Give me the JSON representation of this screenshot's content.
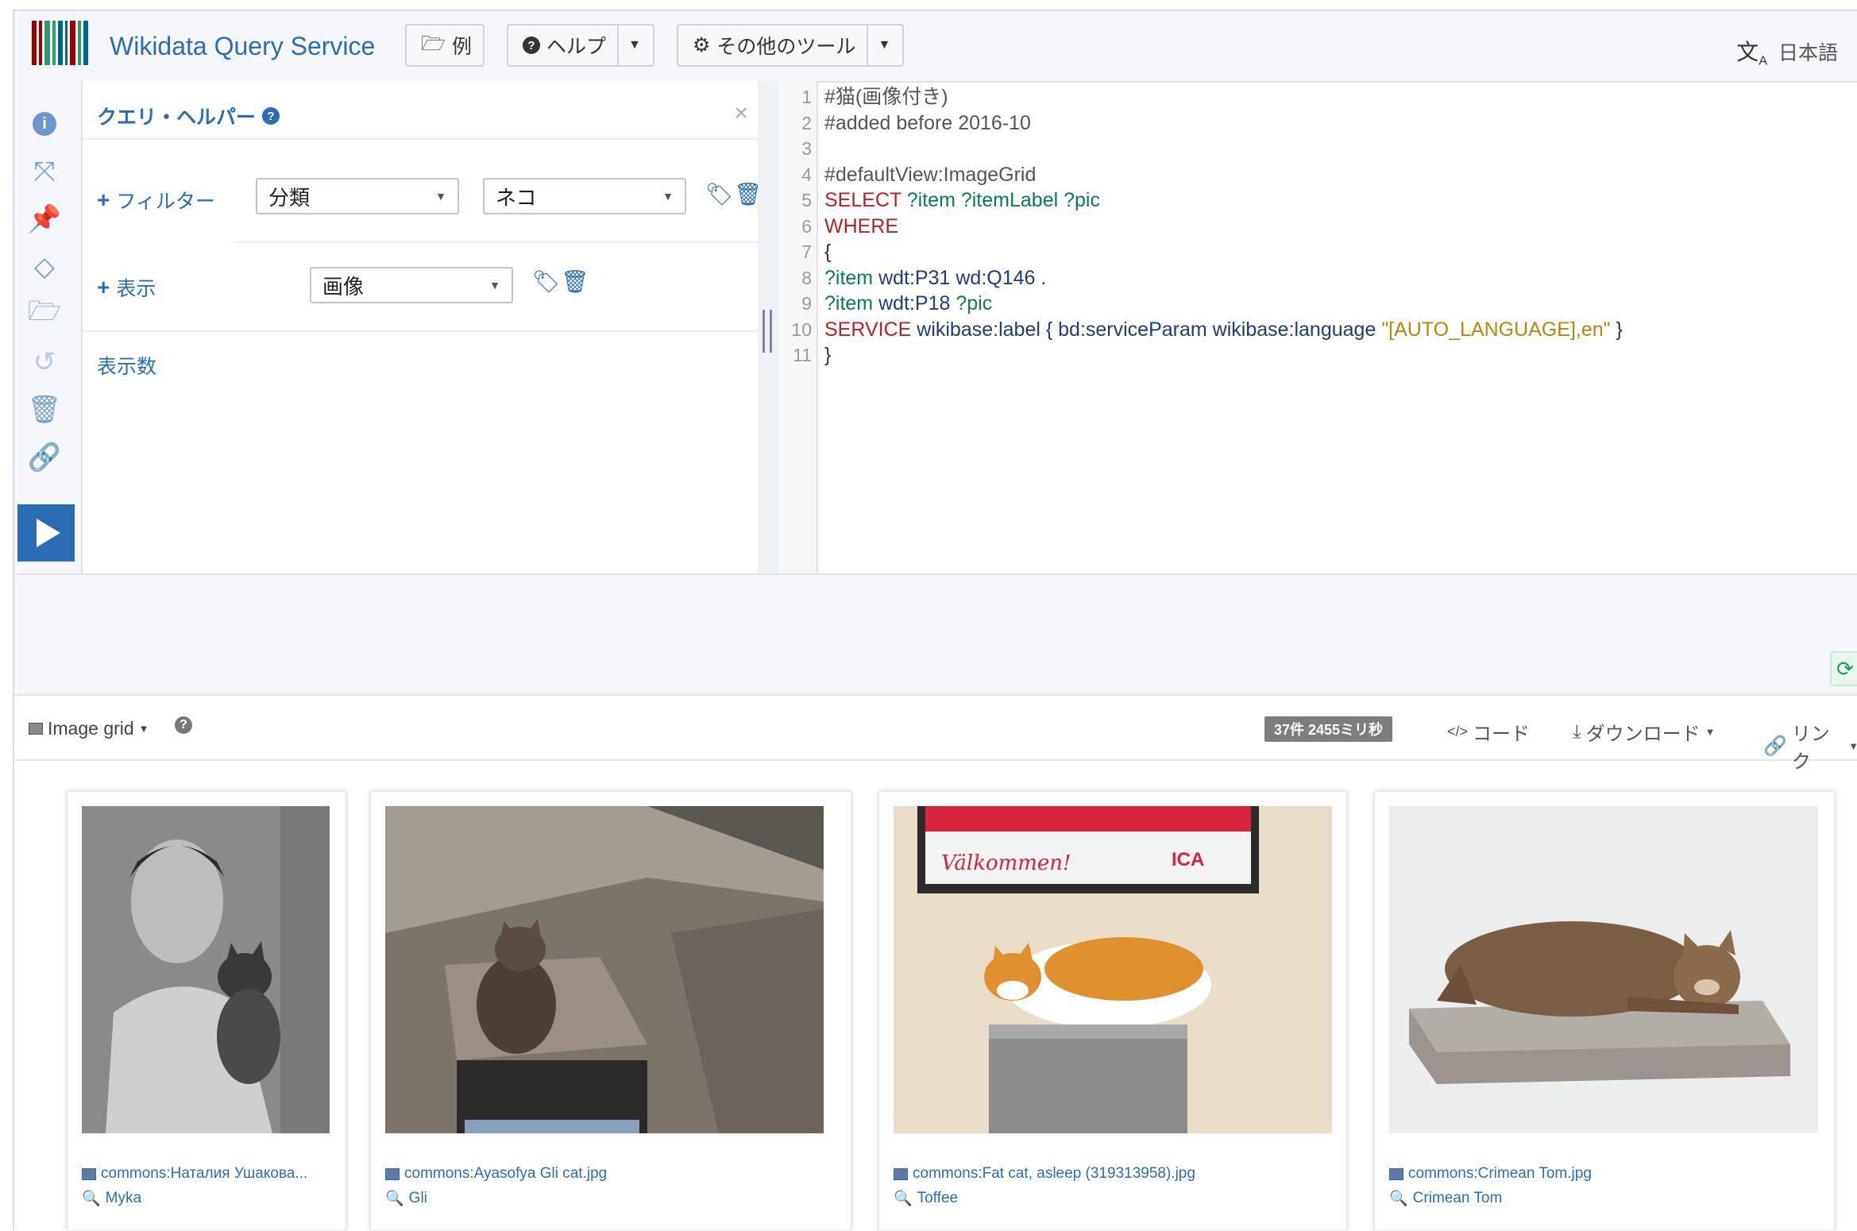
{
  "navbar": {
    "brand": "Wikidata Query Service",
    "examples_label": "例",
    "help_label": "ヘルプ",
    "more_tools_label": "その他のツール",
    "language_label": "日本語"
  },
  "helper": {
    "title": "クエリ・ヘルパー",
    "filter_add_label": "フィルター",
    "filter_property_value": "分類",
    "filter_item_value": "ネコ",
    "show_add_label": "表示",
    "show_property_value": "画像",
    "limit_label": "表示数"
  },
  "editor": {
    "line_numbers": [
      "1",
      "2",
      "3",
      "4",
      "5",
      "6",
      "7",
      "8",
      "9",
      "10",
      "11"
    ],
    "lines": [
      [
        {
          "t": "#猫(画像付き)",
          "c": "cmt"
        }
      ],
      [
        {
          "t": "#added before 2016-10",
          "c": "cmt"
        }
      ],
      [
        {
          "t": "",
          "c": "cmt"
        }
      ],
      [
        {
          "t": "#defaultView:ImageGrid",
          "c": "cmt"
        }
      ],
      [
        {
          "t": "SELECT",
          "c": "kw"
        },
        {
          "t": " ",
          "c": ""
        },
        {
          "t": "?item ?itemLabel ?pic",
          "c": "var"
        }
      ],
      [
        {
          "t": "WHERE",
          "c": "kw"
        }
      ],
      [
        {
          "t": "{",
          "c": ""
        }
      ],
      [
        {
          "t": "?item",
          "c": "var"
        },
        {
          "t": " wdt:P31 wd:Q146 .",
          "c": "pfx"
        }
      ],
      [
        {
          "t": "?item",
          "c": "var"
        },
        {
          "t": " wdt:P18 ",
          "c": "pfx"
        },
        {
          "t": "?pic",
          "c": "var"
        }
      ],
      [
        {
          "t": "SERVICE",
          "c": "kw"
        },
        {
          "t": " wikibase:label { bd:serviceParam wikibase:language ",
          "c": "pfx"
        },
        {
          "t": "\"[AUTO_LANGUAGE],en\"",
          "c": "str"
        },
        {
          "t": " }",
          "c": ""
        }
      ],
      [
        {
          "t": "}",
          "c": ""
        }
      ]
    ]
  },
  "results": {
    "view_label": "Image grid",
    "stats": "37件 2455ミリ秒",
    "code_label": "コード",
    "download_label": "ダウンロード",
    "link_label": "リンク",
    "cards": [
      {
        "file": "commons:Наталия Ушакова...",
        "label": "Myka"
      },
      {
        "file": "commons:Ayasofya Gli cat.jpg",
        "label": "Gli"
      },
      {
        "file": "commons:Fat cat, asleep (319313958).jpg",
        "label": "Toffee"
      },
      {
        "file": "commons:Crimean Tom.jpg",
        "label": "Crimean Tom"
      }
    ],
    "photo_texts": {
      "sign_left": "Välkommen!",
      "sign_right": "ICA"
    }
  },
  "colors": {
    "accent": "#2a6db5",
    "keyword": "#b4232a",
    "variable": "#0a7a5b",
    "string": "#b7860b"
  }
}
